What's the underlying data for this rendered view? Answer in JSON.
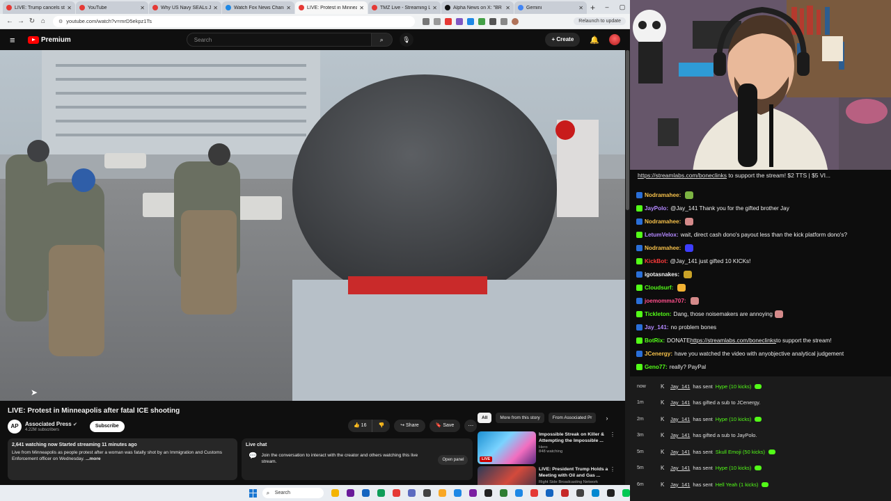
{
  "browser": {
    "tabs": [
      {
        "title": "LIVE: Trump cancels strikes",
        "color": "#e53935"
      },
      {
        "title": "YouTube",
        "color": "#e53935"
      },
      {
        "title": "Why US Navy SEALs Just",
        "color": "#e53935"
      },
      {
        "title": "Watch Fox News Chann",
        "color": "#1e88e5"
      },
      {
        "title": "LIVE: Protest in Minnea",
        "color": "#e53935",
        "active": true
      },
      {
        "title": "TMZ Live - Streaming Liv",
        "color": "#e53935"
      },
      {
        "title": "Alpha News on X: \"BR",
        "color": "#111111"
      },
      {
        "title": "Gemini",
        "color": "#4285f4"
      }
    ],
    "url": "youtube.com/watch?v=mrD5ekpz1Ts",
    "relaunch_label": "Relaunch to update"
  },
  "youtube": {
    "brand": "Premium",
    "search_placeholder": "Search",
    "create_label": "Create"
  },
  "video": {
    "title": "LIVE: Protest in Minneapolis after fatal ICE shooting",
    "channel": "Associated Press",
    "channel_initials": "AP",
    "subscribers": "4.22M subscribers",
    "subscribe_label": "Subscribe",
    "likes": "16",
    "share_label": "Share",
    "save_label": "Save",
    "description": {
      "stats": "2,641 watching now  Started streaming 11 minutes ago",
      "text": "Live from Minneapolis as people protest after a woman was fatally shot by an Immigration and Customs Enforcement officer on Wednesday.",
      "more": "...more"
    },
    "live_chat": {
      "title": "Live chat",
      "text": "Join the conversation to interact with the creator and others watching this live stream.",
      "open_panel": "Open panel"
    }
  },
  "recommendations": {
    "chips": [
      "All",
      "More from this story",
      "From Associated Pr"
    ],
    "items": [
      {
        "title": "Impossible Streak on Killer & Attempting the Impossible ...",
        "channel": "Hero",
        "views": "848 watching",
        "badge": "LIVE"
      },
      {
        "title": "LIVE: President Trump Holds a Meeting with Oil and Gas ...",
        "channel": "Right Side Broadcasting Network",
        "views": "",
        "badge": ""
      }
    ]
  },
  "chat": {
    "banner_link": "https://streamlabs.com/boneclinks",
    "banner_text": " to support the stream! $2 TTS | $5 VI...",
    "messages": [
      {
        "user": "Nodramahee:",
        "color": "#f5c04a",
        "text": "",
        "emote": "#7cb342"
      },
      {
        "user": "JayPolo:",
        "color": "#b388ff",
        "text": "@Jay_141 Thank you for the gifted brother Jay"
      },
      {
        "user": "Nodramahee:",
        "color": "#f5c04a",
        "text": "",
        "emote": "#d48a8a"
      },
      {
        "user": "LetumVelox:",
        "color": "#b388ff",
        "text": "wait, direct cash dono's payout less than the kick platform dono's?"
      },
      {
        "user": "Nodramahee:",
        "color": "#f5c04a",
        "text": "",
        "emote": "#3d3dff"
      },
      {
        "user": "KickBot:",
        "color": "#ff3b3b",
        "text": "@Jay_141 just gifted 10 KICKs!"
      },
      {
        "user": "igotasnakes:",
        "color": "#f5f5f5",
        "text": "",
        "emote": "#c9a227"
      },
      {
        "user": "Cloudsurf:",
        "color": "#53fc18",
        "text": "",
        "emote": "#f2b233"
      },
      {
        "user": "joemomma707:",
        "color": "#ff4f8b",
        "text": "",
        "emote": "#d48a8a"
      },
      {
        "user": "Tickleton:",
        "color": "#53fc18",
        "text": "Dang, those noisemakers are annoying",
        "emote": "#d48a8a"
      },
      {
        "user": "Jay_141:",
        "color": "#b388ff",
        "text": "no problem bones"
      },
      {
        "user": "BotRix:",
        "color": "#53fc18",
        "text": "DONATE ",
        "link": "https://streamlabs.com/boneclinks",
        "text2": " to support the stream!"
      },
      {
        "user": "JCenergy:",
        "color": "#f5c04a",
        "text": "have you watched the video with anyobjective analytical judgement"
      },
      {
        "user": "Geno77:",
        "color": "#53fc18",
        "text": "really? PayPal"
      }
    ]
  },
  "events": [
    {
      "time": "now",
      "user": "Jay_141",
      "text": "has sent",
      "highlight": "Hype (10 kicks)",
      "icon": true
    },
    {
      "time": "1m",
      "user": "Jay_141",
      "text": "has gifted a sub to JCenergy.",
      "highlight": "",
      "icon": false
    },
    {
      "time": "2m",
      "user": "Jay_141",
      "text": "has sent",
      "highlight": "Hype (10 kicks)",
      "icon": true
    },
    {
      "time": "3m",
      "user": "Jay_141",
      "text": "has gifted a sub to JayPolo.",
      "highlight": "",
      "icon": false
    },
    {
      "time": "5m",
      "user": "Jay_141",
      "text": "has sent",
      "highlight": "Skull Emoji (50 kicks)",
      "icon": true
    },
    {
      "time": "5m",
      "user": "Jay_141",
      "text": "has sent",
      "highlight": "Hype (10 kicks)",
      "icon": true
    },
    {
      "time": "6m",
      "user": "Jay_141",
      "text": "has sent",
      "highlight": "Hell Yeah (1 kicks)",
      "icon": true
    }
  ],
  "taskbar": {
    "search_label": "Search",
    "apps": [
      "#f4b400",
      "#6a1b9a",
      "#1565c0",
      "#0f9d58",
      "#e53935",
      "#5c6bc0",
      "#424242",
      "#f9a825",
      "#1e88e5",
      "#7b1fa2",
      "#212121",
      "#2e7d32",
      "#1e88e5",
      "#e53935",
      "#1565c0",
      "#c62828",
      "#424242",
      "#0288d1",
      "#212121",
      "#00c853"
    ]
  }
}
